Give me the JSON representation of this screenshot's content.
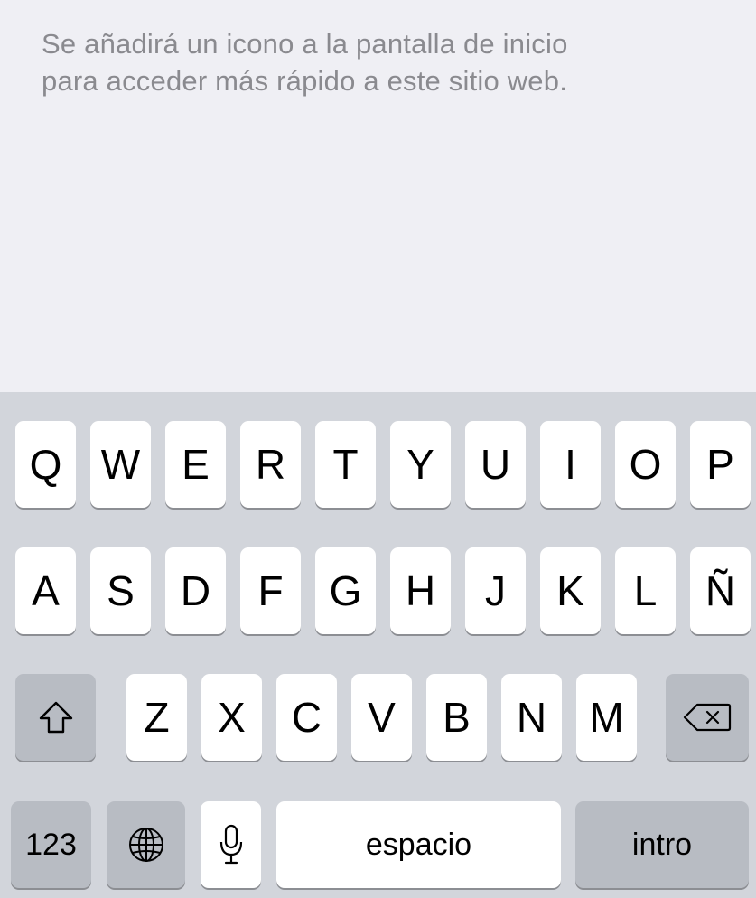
{
  "info": {
    "message_line1": "Se añadirá un icono a la pantalla de inicio",
    "message_line2": "para acceder más rápido a este sitio web."
  },
  "keyboard": {
    "row1": [
      "Q",
      "W",
      "E",
      "R",
      "T",
      "Y",
      "U",
      "I",
      "O",
      "P"
    ],
    "row2": [
      "A",
      "S",
      "D",
      "F",
      "G",
      "H",
      "J",
      "K",
      "L",
      "Ñ"
    ],
    "row3": [
      "Z",
      "X",
      "C",
      "V",
      "B",
      "N",
      "M"
    ],
    "numbers_label": "123",
    "space_label": "espacio",
    "return_label": "intro",
    "icons": {
      "shift": "shift-icon",
      "delete": "delete-backspace-icon",
      "globe": "globe-icon",
      "mic": "microphone-icon"
    },
    "colors": {
      "keyboard_bg": "#d2d5db",
      "key_bg": "#ffffff",
      "function_key_bg": "#b8bcc3",
      "info_bg": "#efeff4",
      "info_text": "#8a8a8f"
    }
  }
}
